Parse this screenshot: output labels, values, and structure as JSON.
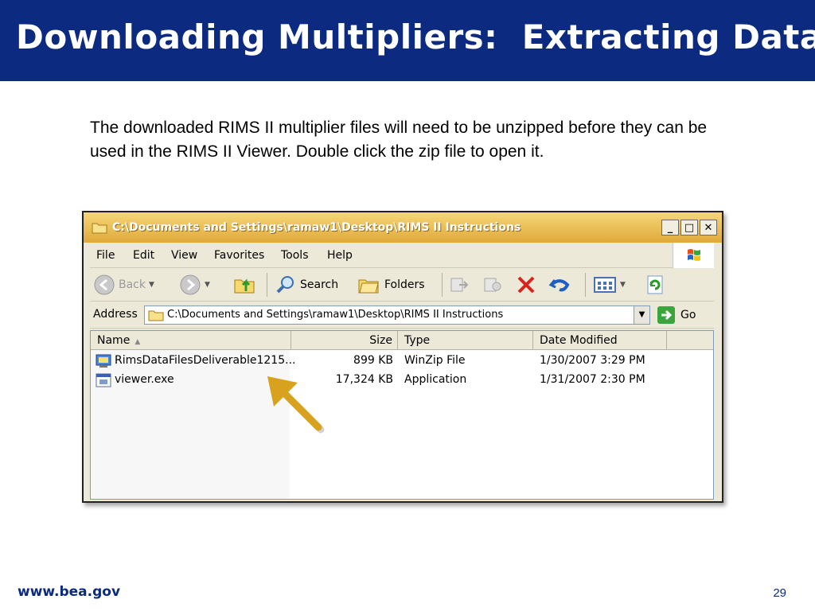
{
  "slide": {
    "title": "Downloading Multipliers:  Extracting Data",
    "intro": "The downloaded RIMS II multiplier files will need to be unzipped before they can be used in the RIMS II Viewer.  Double click the zip file to open it.",
    "footer_url": "www.bea.gov",
    "page_number": "29"
  },
  "window": {
    "caption": "C:\\Documents and Settings\\ramaw1\\Desktop\\RIMS II Instructions",
    "buttons": {
      "minimize": "_",
      "maximize": "□",
      "close": "✕"
    },
    "menu": [
      "File",
      "Edit",
      "View",
      "Favorites",
      "Tools",
      "Help"
    ],
    "toolbar": {
      "back": "Back",
      "search": "Search",
      "folders": "Folders"
    },
    "address": {
      "label": "Address",
      "value": "C:\\Documents and Settings\\ramaw1\\Desktop\\RIMS II Instructions",
      "go": "Go"
    },
    "columns": [
      "Name",
      "Size",
      "Type",
      "Date Modified"
    ],
    "files": [
      {
        "name": "RimsDataFilesDeliverable1215...",
        "size": "899 KB",
        "type": "WinZip File",
        "date": "1/30/2007 3:29 PM",
        "icon": "winzip-icon"
      },
      {
        "name": "viewer.exe",
        "size": "17,324 KB",
        "type": "Application",
        "date": "1/31/2007 2:30 PM",
        "icon": "application-icon"
      }
    ]
  },
  "colors": {
    "title_bar": "#0b2a80",
    "caption_gradient_top": "#f6d679",
    "caption_gradient_bottom": "#e0a93a",
    "arrow": "#d9a21e"
  }
}
